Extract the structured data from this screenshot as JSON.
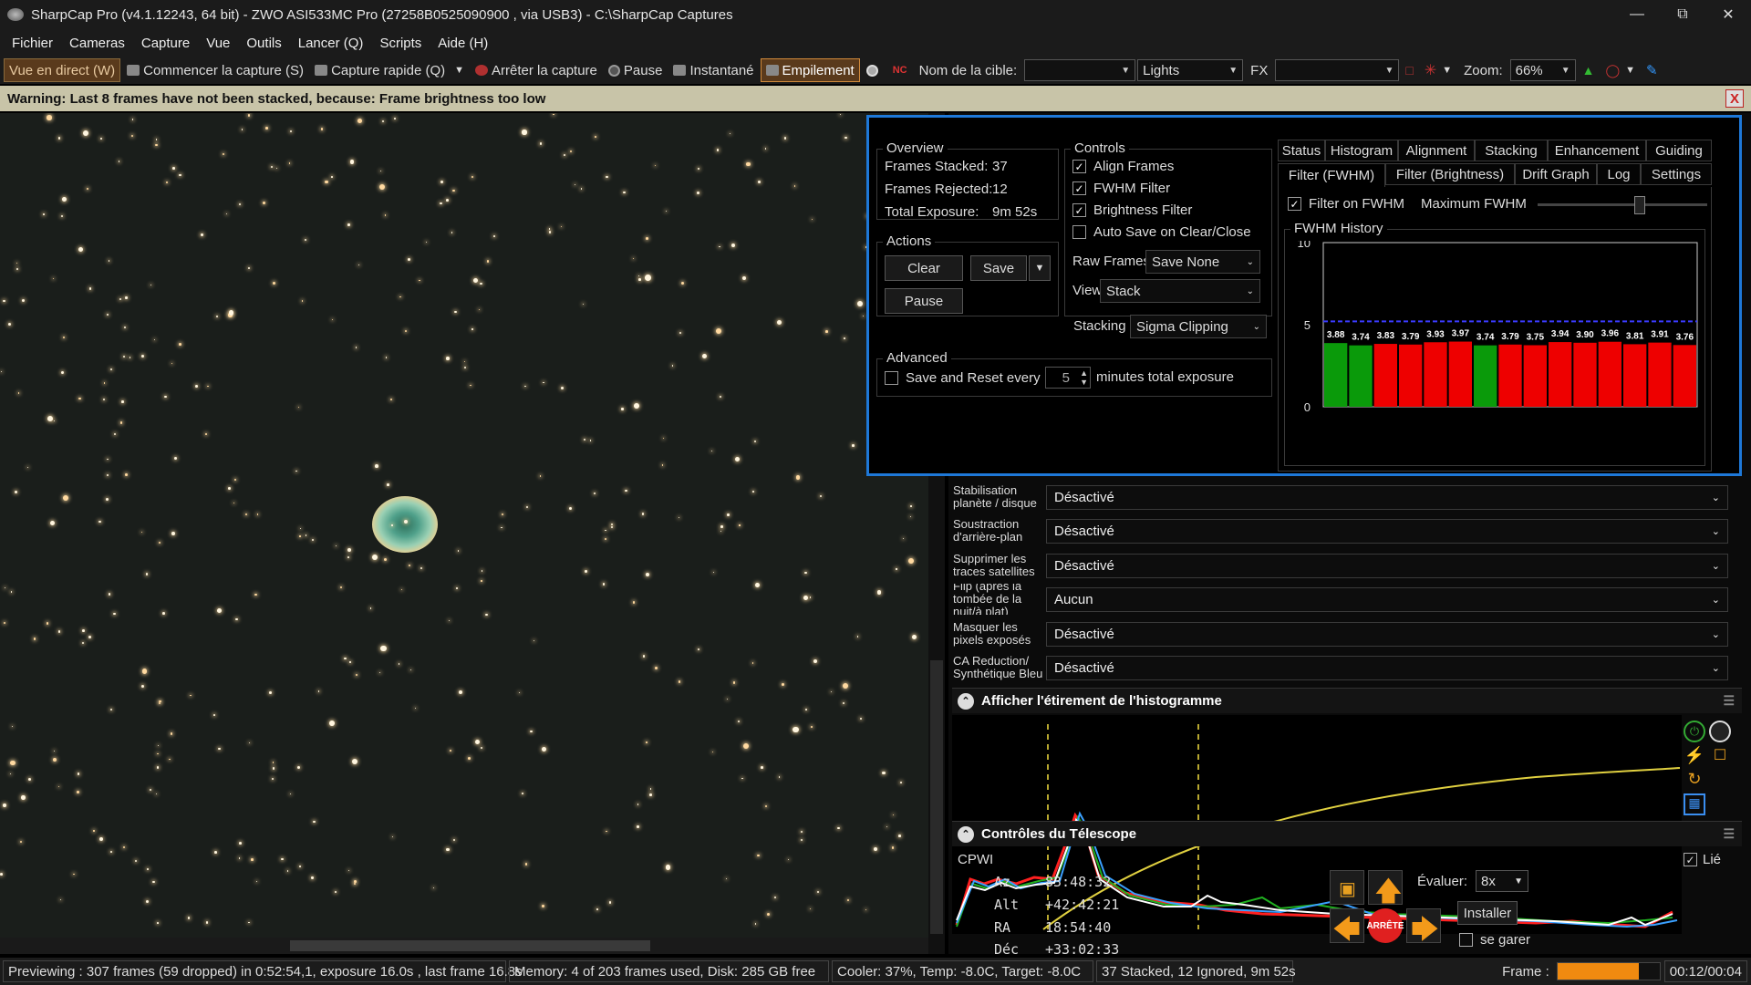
{
  "window": {
    "title": "SharpCap Pro (v4.1.12243, 64 bit) - ZWO ASI533MC Pro (27258B0525090900 , via USB3) - C:\\SharpCap Captures"
  },
  "menu": [
    "Fichier",
    "Cameras",
    "Capture",
    "Vue",
    "Outils",
    "Lancer (Q)",
    "Scripts",
    "Aide (H)"
  ],
  "toolbar": {
    "live": "Vue en direct (W)",
    "start_capture": "Commencer la capture (S)",
    "quick_capture": "Capture rapide (Q)",
    "stop_capture": "Arrêter la capture",
    "pause": "Pause",
    "snapshot": "Instantané",
    "stacking": "Empilement",
    "target_label": "Nom de la cible:",
    "target_value": "",
    "frame_type": "Lights",
    "fx_label": "FX",
    "fx_value": "",
    "zoom_label": "Zoom:",
    "zoom_value": "66%"
  },
  "warning": {
    "text": "Warning: Last 8 frames have not been stacked, because: Frame brightness too low",
    "close": "X"
  },
  "stacking": {
    "overview": {
      "title": "Overview",
      "frames_stacked_label": "Frames Stacked:",
      "frames_stacked": "37",
      "frames_rejected_label": "Frames Rejected:",
      "frames_rejected": "12",
      "total_exposure_label": "Total Exposure:",
      "total_exposure": "9m 52s"
    },
    "actions": {
      "title": "Actions",
      "clear": "Clear",
      "save": "Save",
      "pause": "Pause"
    },
    "controls": {
      "title": "Controls",
      "align_frames": "Align Frames",
      "fwhm_filter": "FWHM Filter",
      "brightness_filter": "Brightness Filter",
      "auto_save": "Auto Save on Clear/Close",
      "raw_frames_label": "Raw Frames",
      "raw_frames_value": "Save None",
      "view_label": "View",
      "view_value": "Stack",
      "stacking_label": "Stacking",
      "stacking_value": "Sigma Clipping"
    },
    "advanced": {
      "title": "Advanced",
      "save_reset_label": "Save and Reset every",
      "minutes_value": "5",
      "minutes_suffix": "minutes total exposure"
    },
    "tabs_row1": [
      "Status",
      "Histogram",
      "Alignment",
      "Stacking",
      "Enhancement",
      "Guiding"
    ],
    "tabs_row2": [
      "Filter (FWHM)",
      "Filter (Brightness)",
      "Drift Graph",
      "Log",
      "Settings"
    ],
    "filter_on_fwhm": "Filter on FWHM",
    "max_fwhm_label": "Maximum FWHM",
    "max_fwhm_slider": 0.6,
    "history_title": "FWHM History"
  },
  "chart_data": {
    "type": "bar",
    "title": "FWHM History",
    "ylim": [
      0,
      10
    ],
    "yticks": [
      "10",
      "5",
      "0"
    ],
    "threshold": 5.2,
    "values": [
      3.88,
      3.74,
      3.83,
      3.79,
      3.93,
      3.97,
      3.74,
      3.79,
      3.75,
      3.94,
      3.9,
      3.96,
      3.81,
      3.91,
      3.76
    ],
    "labels": [
      "3.88",
      "3.74",
      "3.83",
      "3.79",
      "3.93",
      "3.97",
      "3.74",
      "3.79",
      "3.75",
      "3.94",
      "3.90",
      "3.96",
      "3.81",
      "3.91",
      "3.76"
    ],
    "accepted": [
      true,
      true,
      false,
      false,
      false,
      false,
      true,
      false,
      false,
      false,
      false,
      false,
      false,
      false,
      false
    ],
    "colors": {
      "accepted": "#0a9a0a",
      "rejected": "#ee0000",
      "threshold": "#3a3aff"
    }
  },
  "processing": [
    {
      "label": "Stabilisation planète / disque",
      "value": "Désactivé"
    },
    {
      "label": "Soustraction d'arrière-plan",
      "value": "Désactivé"
    },
    {
      "label": "Supprimer les traces satellites",
      "value": "Désactivé"
    },
    {
      "label": "Flip (après la tombée de la nuit/à plat)",
      "value": "Aucun"
    },
    {
      "label": "Masquer les pixels exposés",
      "value": "Désactivé"
    },
    {
      "label": "CA Reduction/ Synthétique Bleu",
      "value": "Désactivé"
    }
  ],
  "histogram": {
    "title": "Afficher l'étirement de l'histogramme"
  },
  "telescope": {
    "title": "Contrôles du Télescope",
    "mount": "CPWI",
    "linked": "Lié",
    "az_label": "Az",
    "az": "83:48:32",
    "alt_label": "Alt",
    "alt": "+42:42:21",
    "ra_label": "RA",
    "ra": "18:54:40",
    "dec_label": "Déc",
    "dec": "+33:02:33",
    "rate_label": "Évaluer:",
    "rate_value": "8x",
    "install": "Installer",
    "park": "se garer",
    "stop": "ARRÊTE"
  },
  "status": {
    "preview": "Previewing : 307 frames (59 dropped) in 0:52:54,1, exposure 16.0s , last frame 16.8s",
    "memory": "Memory: 4 of 203 frames used, Disk: 285 GB free",
    "cooler": "Cooler: 37%, Temp: -8.0C, Target: -8.0C",
    "stacked": "37 Stacked, 12 Ignored, 9m 52s",
    "frame_label": "Frame :",
    "frame_progress": 0.8,
    "time": "00:12/00:04"
  }
}
